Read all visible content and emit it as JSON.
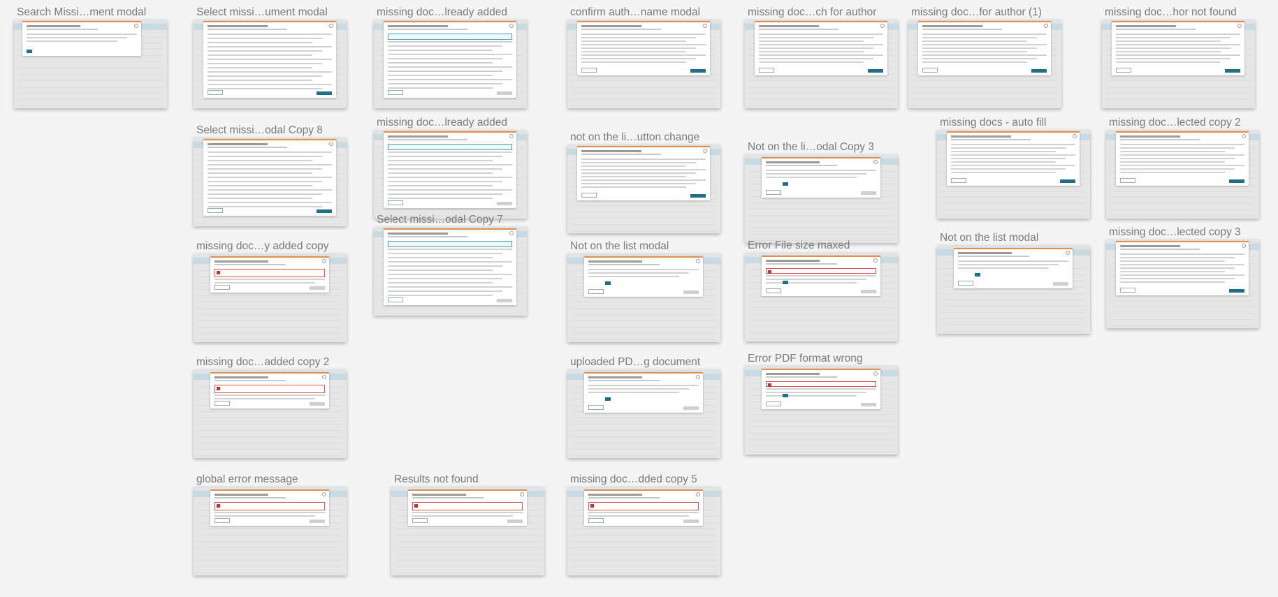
{
  "artboards": [
    {
      "name": "Search Missi…ment modal",
      "variant": "search"
    },
    {
      "name": "Select missi…ument modal",
      "variant": "table"
    },
    {
      "name": "missing doc…lready added",
      "variant": "table-info"
    },
    {
      "name": "confirm auth…name modal",
      "variant": "confirm"
    },
    {
      "name": "missing doc…ch for author",
      "variant": "author"
    },
    {
      "name": "missing doc…for author (1)",
      "variant": "author"
    },
    {
      "name": "missing doc…hor not found",
      "variant": "author"
    },
    {
      "name": "Select missi…odal Copy 8",
      "variant": "table"
    },
    {
      "name": "missing doc…lready added",
      "variant": "table-info"
    },
    {
      "name": "not on the li…utton change",
      "variant": "confirm"
    },
    {
      "name": "Not on the li…odal Copy 3",
      "variant": "upload"
    },
    {
      "name": "missing docs - auto fill",
      "variant": "author"
    },
    {
      "name": "missing doc…lected copy 2",
      "variant": "author"
    },
    {
      "name": "missing doc…y added copy",
      "variant": "error"
    },
    {
      "name": "Select missi…odal Copy 7",
      "variant": "table-info"
    },
    {
      "name": "Not on the list modal",
      "variant": "upload"
    },
    {
      "name": "Error File size maxed",
      "variant": "upload-error"
    },
    {
      "name": "Not on the list modal",
      "variant": "upload"
    },
    {
      "name": "missing doc…lected copy 3",
      "variant": "author"
    },
    {
      "name": "missing doc…added copy 2",
      "variant": "error"
    },
    {
      "name": "uploaded PD…g document",
      "variant": "upload"
    },
    {
      "name": "Error PDF format wrong",
      "variant": "upload-error"
    },
    {
      "name": "global error message",
      "variant": "error"
    },
    {
      "name": "Results not found",
      "variant": "error"
    },
    {
      "name": "missing doc…dded copy 5",
      "variant": "error"
    }
  ]
}
